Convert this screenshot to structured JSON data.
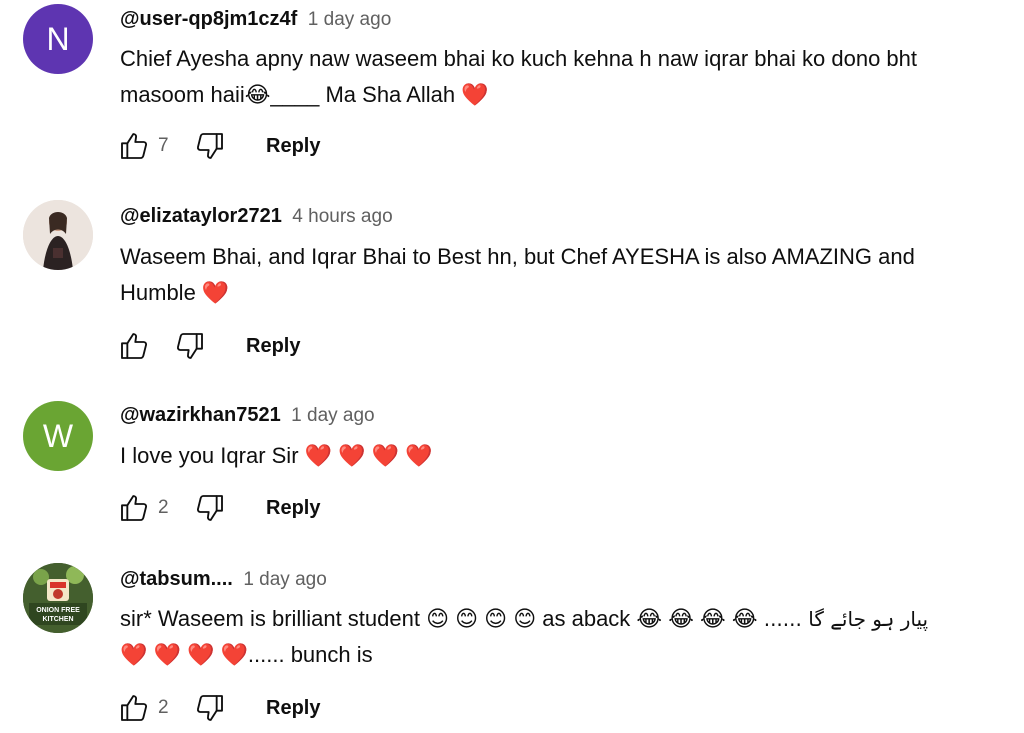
{
  "comments": [
    {
      "avatar_letter": "N",
      "avatar_color": "#5e35b1",
      "handle": "@user-qp8jm1cz4f",
      "time": "1 day ago",
      "line1": "Chief Ayesha apny naw waseem bhai ko kuch kehna h naw iqrar bhai ko dono bht",
      "line2": "masoom haii😂____ Ma Sha Allah ❤️",
      "likes": "7",
      "reply": "Reply"
    },
    {
      "avatar_letter": "",
      "avatar_color": "#e8e0da",
      "handle": "@elizataylor2721",
      "time": "4 hours ago",
      "line1": "Waseem Bhai, and Iqrar Bhai to Best hn, but Chef AYESHA is also AMAZING and",
      "line2": "Humble ❤️",
      "likes": "",
      "reply": "Reply"
    },
    {
      "avatar_letter": "W",
      "avatar_color": "#6aa533",
      "handle": "@wazirkhan7521",
      "time": "1 day ago",
      "line1": "I love you Iqrar Sir ❤️ ❤️ ❤️ ❤️",
      "line2": "",
      "likes": "2",
      "reply": "Reply"
    },
    {
      "avatar_letter": "",
      "avatar_color": "#3d5a2a",
      "avatar_text": "ONION FREE KITCHEN",
      "handle": "@tabsum....",
      "time": "1 day ago",
      "line1": "sir* Waseem is brilliant student 😊 😊 😊 😊 as aback 😂 😂 😂 😂",
      "line1_urdu": "پیار ہو جائے گا ......",
      "line2": "❤️ ❤️ ❤️ ❤️...... bunch is",
      "likes": "2",
      "reply": "Reply"
    }
  ],
  "icons": {
    "like": "thumbs-up-icon",
    "dislike": "thumbs-down-icon"
  }
}
